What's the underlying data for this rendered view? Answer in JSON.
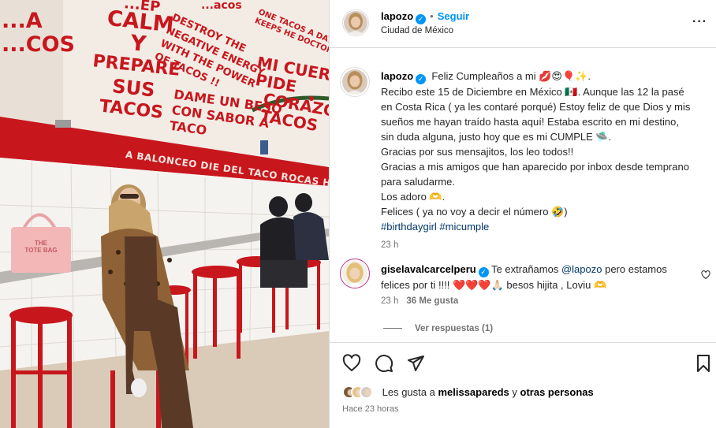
{
  "photo": {
    "wall_text_1": [
      "...EP",
      "CALM",
      "Y",
      "PREPARE",
      "SUS",
      "TACOS"
    ],
    "wall_text_left": [
      "...A",
      "...COS"
    ],
    "wall_text_2": [
      "DESTROY THE",
      "NEGATIVE ENERGY",
      "WITH THE POWER",
      "OF TACOS !!"
    ],
    "wall_text_3": [
      "ONE TACOS A DAY",
      "KEEPS HE DOCTOR AWAY"
    ],
    "wall_text_4": [
      "MI CUERPO",
      "PIDE",
      "CORAZON",
      "TACOS"
    ],
    "wall_text_5": [
      "DAME UN BESO",
      "CON SABOR A",
      "TACO"
    ],
    "wall_text_top": "...acos",
    "banner": "A BALONCEO DIE DEL TACO ROCAS HAGO",
    "bag_label": [
      "THE",
      "TOTE BAG"
    ]
  },
  "header": {
    "username": "lapozo",
    "verified_mark": "✓",
    "separator": "•",
    "follow": "Seguir",
    "location": "Ciudad de México",
    "more": "···"
  },
  "caption": {
    "username": "lapozo",
    "verified_mark": "✓",
    "first_line": "Feliz Cumpleaños a mi 💋😍🎈✨.",
    "lines": [
      "Recibo este 15 de Diciembre en México 🇲🇽. Aunque las 12 la pasé",
      "en Costa Rica ( ya les contaré porqué) Estoy feliz de que Dios y mis",
      "sueños me hayan traído hasta aquí! Estaba escrito en mi destino,",
      "sin duda alguna, justo hoy que es mi CUMPLE 🛸.",
      "Gracias por sus mensajitos, los leo todos!!",
      "Gracias a mis amigos que han aparecido por inbox desde temprano",
      "para saludarme.",
      "Los adoro 🫶.",
      "Felices ( ya no voy a decir el número 🤣)"
    ],
    "hashtags": "#birthdaygirl #micumple",
    "time": "23 h"
  },
  "comment": {
    "username": "giselavalcarcelperu",
    "verified_mark": "✓",
    "text_before": " Te extrañamos ",
    "mention": "@lapozo",
    "text_after": " pero estamos",
    "text_line2": "felices por ti !!!! ❤️❤️❤️🙏🏻 besos hijita , Loviu 🫶",
    "time": "23 h",
    "likes": "36 Me gusta",
    "replies": "Ver respuestas (1)"
  },
  "actions": {
    "likes_prefix": "Les gusta a ",
    "likes_user": "melissapareds",
    "likes_middle": " y ",
    "likes_others": "otras personas",
    "ago": "Hace 23 horas"
  },
  "colors": {
    "accent": "#0095f6",
    "link": "#00376b",
    "wall_red": "#c8161d",
    "heart_red": "#ed4956"
  }
}
